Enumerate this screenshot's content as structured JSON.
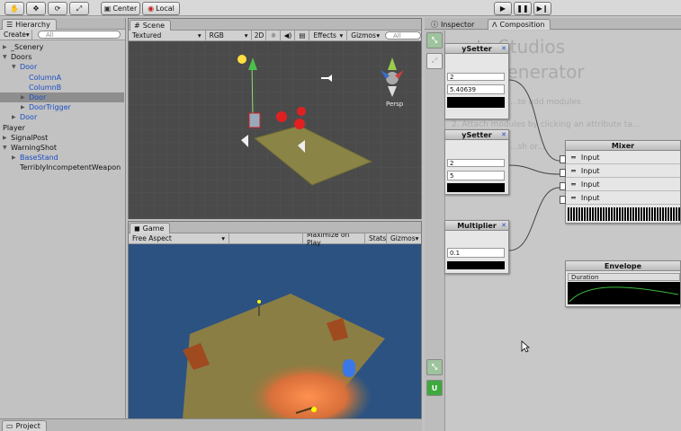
{
  "toolbar": {
    "tools": [
      "hand-icon",
      "move-icon",
      "rotate-icon",
      "scale-icon"
    ],
    "pivot_center": "Center",
    "pivot_local": "Local"
  },
  "hierarchy": {
    "tab": "Hierarchy",
    "create": "Create",
    "search_placeholder": "All",
    "items": [
      {
        "label": "_Scenery",
        "indent": 0,
        "arrow": "closed",
        "prefab": false
      },
      {
        "label": "Doors",
        "indent": 0,
        "arrow": "open",
        "prefab": false
      },
      {
        "label": "Door",
        "indent": 1,
        "arrow": "open",
        "prefab": true
      },
      {
        "label": "ColumnA",
        "indent": 2,
        "arrow": "",
        "prefab": true
      },
      {
        "label": "ColumnB",
        "indent": 2,
        "arrow": "",
        "prefab": true
      },
      {
        "label": "Door",
        "indent": 2,
        "arrow": "closed",
        "prefab": true,
        "selected": true
      },
      {
        "label": "DoorTrigger",
        "indent": 2,
        "arrow": "closed",
        "prefab": true
      },
      {
        "label": "Door",
        "indent": 1,
        "arrow": "closed",
        "prefab": true
      },
      {
        "label": "Player",
        "indent": 0,
        "arrow": "",
        "prefab": false
      },
      {
        "label": "SignalPost",
        "indent": 0,
        "arrow": "closed",
        "prefab": false
      },
      {
        "label": "WarningShot",
        "indent": 0,
        "arrow": "open",
        "prefab": false
      },
      {
        "label": "BaseStand",
        "indent": 1,
        "arrow": "closed",
        "prefab": true
      },
      {
        "label": "TerriblyIncompetentWeapon",
        "indent": 1,
        "arrow": "",
        "prefab": false
      }
    ]
  },
  "project": {
    "tab": "Project"
  },
  "scene": {
    "tab": "Scene",
    "shading": "Textured",
    "render_mode": "RGB",
    "mode_2d": "2D",
    "effects": "Effects",
    "gizmos": "Gizmos",
    "search_placeholder": "All",
    "persp": "Persp"
  },
  "game": {
    "tab": "Game",
    "aspect": "Free Aspect",
    "maximize": "Maximize on Play",
    "stats": "Stats",
    "gizmos": "Gizmos"
  },
  "play": {
    "icons": [
      "play-icon",
      "pause-icon",
      "step-icon"
    ]
  },
  "right_tabs": {
    "inspector": "Inspector",
    "composition": "Composition"
  },
  "composition": {
    "bg_title_1": "...rts Studios",
    "bg_title_2": "Generator",
    "bg_line_1": "...to add modules",
    "bg_line_2": "2. Attach modules by clicking an attribute ta...",
    "bg_line_3": "...sh or...",
    "nodes": {
      "setter1": {
        "title": "ySetter",
        "dropdown": "2",
        "value": "5.40639"
      },
      "setter2": {
        "title": "ySetter",
        "dropdown": "2",
        "value": "5"
      },
      "multiplier": {
        "title": "Multiplier",
        "value": "0.1"
      },
      "mixer": {
        "title": "Mixer",
        "inputs": [
          "Input",
          "Input",
          "Input",
          "Input"
        ]
      },
      "envelope": {
        "title": "Envelope",
        "field": "Duration"
      }
    }
  }
}
